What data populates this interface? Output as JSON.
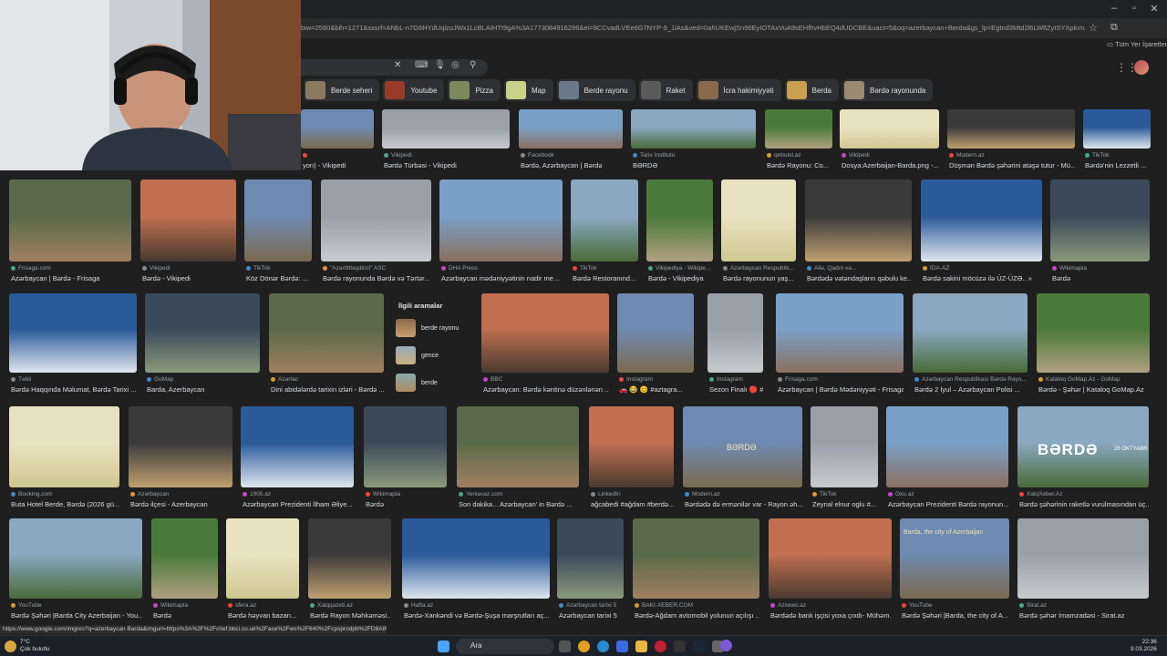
{
  "window": {
    "minimize": "–",
    "maximize": "▫",
    "close": "✕"
  },
  "address": {
    "url": "biw=2560&bih=1271&sxsrf=ANbL-n7G6HYdUqlzoJWx1LcBLAIHTt9gA%3A1773084916296&ei=9CCvadLVEe6G7NYP-9_1iAs&ved=0ahUKEwjSn96EyIOTAxVuA9sEHfhvHbEQ4dUDCBE&uact=5&oq=azerbaycan+Berda&gs_lp=Egtnd3Mtd2l6LWltZyISYXplcmJheWNhbiBCYZ1ZYMm",
    "bookmarks_label": "Tüm Yer İşaretleri"
  },
  "colors": {
    "bg": "#1f1f1f",
    "chip": "#2f3033",
    "accent": "#8ab4f8"
  },
  "chips": [
    {
      "label": "Berde seheri",
      "c": "#8a7a60"
    },
    {
      "label": "Youtube",
      "c": "#9a3a2a"
    },
    {
      "label": "Pizza",
      "c": "#7a8a5a"
    },
    {
      "label": "Map",
      "c": "#c9d28a"
    },
    {
      "label": "Berde rayonu",
      "c": "#6a7a8a"
    },
    {
      "label": "Raket",
      "c": "#5a5a5a"
    },
    {
      "label": "İcra hakimiyyəti",
      "c": "#8a6a4a"
    },
    {
      "label": "Berda",
      "c": "#c9a050"
    },
    {
      "label": "Bərdə rayonunda",
      "c": "#9a8a70"
    }
  ],
  "row0": [
    {
      "src": "",
      "title": "yon) - Vikipedi"
    },
    {
      "src": "Vikipedi",
      "title": "Bərdə Türbəsi - Vikipedi"
    },
    {
      "src": "Facebook",
      "title": "Bərdə, Azərbaycan | Bərdə"
    },
    {
      "src": "Tarix İnstitutu",
      "title": "BƏRDƏ"
    },
    {
      "src": "qebulol.az",
      "title": "Bərdə Rayonu: Co..."
    },
    {
      "src": "Vikipedi",
      "title": "Dosya:Azerbaijan-Barda.png -..."
    },
    {
      "src": "Modern.az",
      "title": "Düşmən Bərdə şəhərini atəşə tutur - Mü..."
    },
    {
      "src": "TikTok",
      "title": "Bərdə'nin Lezzetli ..."
    }
  ],
  "row1": [
    {
      "src": "Frisaga.com",
      "title": "Azərbaycan | Bərdə - Frisaga"
    },
    {
      "src": "Vikipedi",
      "title": "Bərdə - Vikipedi"
    },
    {
      "src": "TikTok",
      "title": "Köz Dönər Bərdə: ..."
    },
    {
      "src": "\"Azərttitləşdirici\" ASC",
      "title": "Bərdə rayonunda Bərdə və Tərtər..."
    },
    {
      "src": "DHA Press",
      "title": "Azərbaycan mədəniyyətinin nadir me..."
    },
    {
      "src": "TikTok",
      "title": "Bərdə Restoranınd..."
    },
    {
      "src": "Vikipediya - Wikipe...",
      "title": "Bərdə - Vikipediya"
    },
    {
      "src": "Azərbaycan Respublik...",
      "title": "Bərdə rayonunun yaş..."
    },
    {
      "src": "Ailə, Qadın və...",
      "title": "Bərdədə vətəndaşların qəbulu ke... »"
    },
    {
      "src": "İDA-AZ",
      "title": "Bərdə sakini möcüzə ilə ÜZ-ÜZƏ.. »"
    },
    {
      "src": "Wikimapia",
      "title": "Bərdə"
    }
  ],
  "row2": [
    {
      "src": "Təbii",
      "title": "Bərdə Haqqında Məlumat, Bərdə Tarixi ..."
    },
    {
      "src": "GoMap",
      "title": "Barda, Azerbaycan"
    },
    {
      "src": "Azərtac",
      "title": "Dini abidələrdə tarixin izləri - Bərdə ..."
    },
    {
      "src": "BBC",
      "title": "Azərbaycan: Bərdə kəntinə düzənlənən ..."
    },
    {
      "src": "Instagram",
      "title": "🚗 😂 😊 #aztagra..."
    },
    {
      "src": "Instagram",
      "title": "Sezon Finalı 🔴 #il..."
    },
    {
      "src": "Frisaga.com",
      "title": "Azərbaycan | Bərdə Mədəniyyəti - Frisaga"
    },
    {
      "src": "Azərbaycan Respublikası Bərdə Rayo...",
      "title": "Bərdə 2 İyul – Azərbaycan Polisi ..."
    },
    {
      "src": "Kataloq GoMap.Az - GoMap",
      "title": "Bərdə - Şəhər | Kataloq GoMap.Az"
    }
  ],
  "related": {
    "heading": "İlgili aramalar",
    "items": [
      "berde rayonu",
      "gence",
      "berde"
    ]
  },
  "row3": [
    {
      "src": "Booking.com",
      "title": "Buta Hotel Berde, Bərdə (2026 gü..."
    },
    {
      "src": "Azərbaycan",
      "title": "Bərdə ilçesi - Azerbaycan"
    },
    {
      "src": "1905.az",
      "title": "Azərbaycan Prezidenti İlham Əliye..."
    },
    {
      "src": "Wikimapia",
      "title": "Bərdə"
    },
    {
      "src": "Yeniavaz.com",
      "title": "Son dakika... Azərbaycan' in Bərdə ..."
    },
    {
      "src": "LinkedIn",
      "title": "ağcabedi #ağdam #berdə..."
    },
    {
      "src": "Modern.az",
      "title": "Bərdədə də ermənilər var - Rayon əh..."
    },
    {
      "src": "TikTok",
      "title": "Zeynal elnur oglu #..."
    },
    {
      "src": "Oxu.az",
      "title": "Azərbaycan Prezidenti Bərdə rayonun..."
    },
    {
      "src": "XalqXeber.Az",
      "title": "Bərdə şəhərinin raketlə vurulmasından üç..."
    }
  ],
  "row4": [
    {
      "src": "YouTube",
      "title": "Bərdə Şəhəri |Barda City Azerbaijan - You..."
    },
    {
      "src": "Wikimapia",
      "title": "Bərdə"
    },
    {
      "src": "sfera.az",
      "title": "Bərdə həyvan bazarı..."
    },
    {
      "src": "Xalqqazeti.az",
      "title": "Bərdə Rayon Məhkəməsi..."
    },
    {
      "src": "Hafta.az",
      "title": "Bərdə-Xankəndi və Bərdə-Şuşa marşrutları aç..."
    },
    {
      "src": "Azərbaycan tarixi 5",
      "title": "Azərbaycan tarixi 5"
    },
    {
      "src": "BAKI-XEBER.COM",
      "title": "Bərdə-Ağdam avtomobil yolunun açılışı ..."
    },
    {
      "src": "Azxews.az",
      "title": "Bərdədə bank işçisi yoxa çıxdı- Mühəm..."
    },
    {
      "src": "YouTube",
      "title": "Bərdə Şəhəri |Barda, the city of A..."
    },
    {
      "src": "Sirat.az",
      "title": "Bərdə şəhər İmamzadəsi - Sirat.az"
    }
  ],
  "image_text": {
    "berde_sign": "BƏRDƏ",
    "berde_date": "28 OKTYABR",
    "city_sign": "Barda, the city of Azerbaijan",
    "berda_gate": "BƏRDƏ"
  },
  "status": {
    "url": "https://www.google.com/imgres?q=azerbaycan Barda&imgurl=https%3A%2F%2Fchef.bbci.co.uk%2Face%2Fws%2F640%2Fcpsprodpb%2FD8A8%2Fproducti..."
  },
  "taskbar": {
    "temp": "7°C",
    "weather": "Çok bulutlu",
    "search": "Ara",
    "time": "22:36",
    "date": "9.03.2026"
  }
}
